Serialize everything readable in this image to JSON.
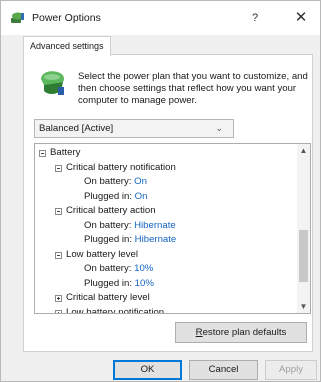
{
  "window": {
    "title": "Power Options",
    "help_label": "?",
    "close_label": "✕"
  },
  "tab": {
    "label": "Advanced settings"
  },
  "intro": {
    "text": "Select the power plan that you want to customize, and then choose settings that reflect how you want your computer to manage power.",
    "icon": "power-plan-icon"
  },
  "plan_select": {
    "value": "Balanced [Active]"
  },
  "tree": {
    "rows": [
      {
        "level": 0,
        "expander": "minus",
        "label": "Battery"
      },
      {
        "level": 1,
        "expander": "minus",
        "label": "Critical battery notification"
      },
      {
        "level": 2,
        "label": "On battery: ",
        "value": "On"
      },
      {
        "level": 2,
        "label": "Plugged in: ",
        "value": "On"
      },
      {
        "level": 1,
        "expander": "minus",
        "label": "Critical battery action"
      },
      {
        "level": 2,
        "label": "On battery: ",
        "value": "Hibernate"
      },
      {
        "level": 2,
        "label": "Plugged in: ",
        "value": "Hibernate"
      },
      {
        "level": 1,
        "expander": "minus",
        "label": "Low battery level"
      },
      {
        "level": 2,
        "label": "On battery: ",
        "value": "10%"
      },
      {
        "level": 2,
        "label": "Plugged in: ",
        "value": "10%"
      },
      {
        "level": 1,
        "expander": "plus",
        "label": "Critical battery level"
      },
      {
        "level": 1,
        "expander": "plus",
        "label": "Low battery notification"
      }
    ],
    "scroll_up": "▲",
    "scroll_down": "▼"
  },
  "buttons": {
    "restore_accel": "R",
    "restore_rest": "estore plan defaults",
    "ok": "OK",
    "cancel": "Cancel",
    "apply": "Apply"
  },
  "colors": {
    "value_text": "#1565c0",
    "ok_border": "#0078d7"
  }
}
